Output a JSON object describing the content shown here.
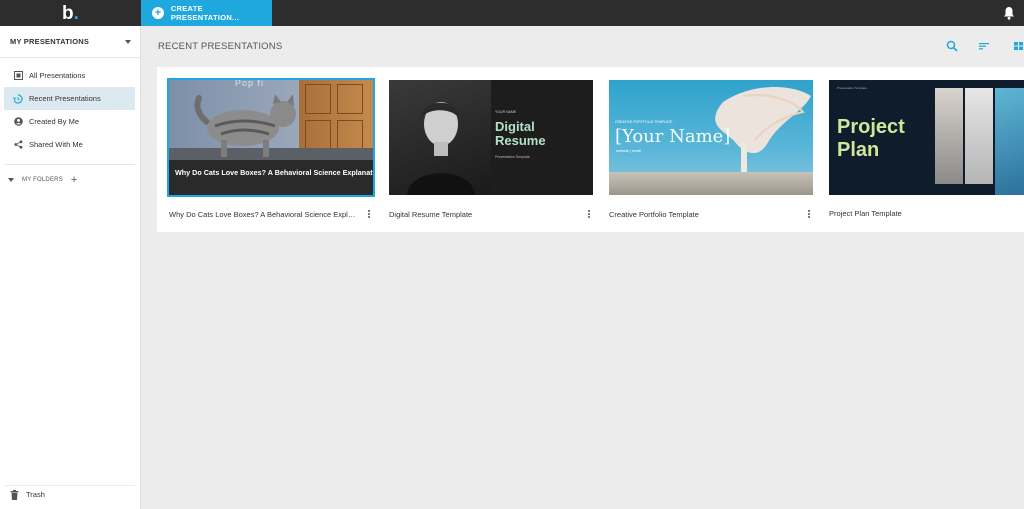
{
  "app": {
    "logo_letter": "b",
    "logo_dot": ".",
    "create_label": "CREATE PRESENTATION...",
    "accent": "#1ea8dd"
  },
  "sidebar": {
    "header": "MY PRESENTATIONS",
    "items": [
      {
        "label": "All Presentations",
        "icon": "grid-icon"
      },
      {
        "label": "Recent Presentations",
        "icon": "history-icon",
        "active": true
      },
      {
        "label": "Created By Me",
        "icon": "person-icon"
      },
      {
        "label": "Shared With Me",
        "icon": "share-icon"
      }
    ],
    "folders_label": "MY FOLDERS",
    "trash_label": "Trash"
  },
  "main": {
    "title": "RECENT PRESENTATIONS",
    "cards": [
      {
        "name": "Why Do Cats Love Boxes? A Behavioral Science Explanat…",
        "thumb_title": "Why Do Cats Love Boxes? A Behavioral Science Explanation",
        "thumb_ghost": "Pop fi"
      },
      {
        "name": "Digital Resume Template",
        "thumb_small": "YOUR NAME",
        "thumb_big_1": "Digital",
        "thumb_big_2": "Resume",
        "thumb_sub": "Presentation Template"
      },
      {
        "name": "Creative Portfolio Template",
        "thumb_tag": "CREATIVE PORTFOLIO TEMPLATE",
        "thumb_name": "[Your Name]",
        "thumb_web": "website | email"
      },
      {
        "name": "Project Plan Template",
        "thumb_small": "Presentation Template",
        "thumb_big_1": "Project",
        "thumb_big_2": "Plan"
      }
    ]
  }
}
